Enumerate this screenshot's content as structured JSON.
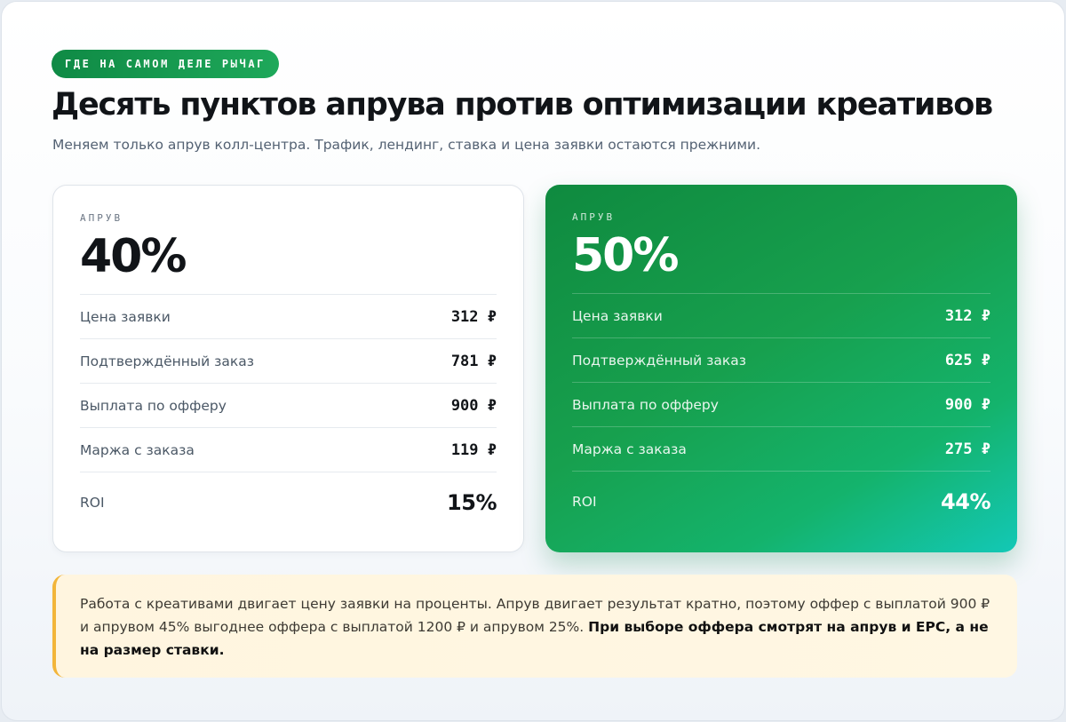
{
  "badge": "ГДЕ НА САМОМ ДЕЛЕ РЫЧАГ",
  "title": "Десять пунктов апрува против оптимизации креативов",
  "subtitle": "Меняем только апрув колл-центра. Трафик, лендинг, ставка и цена заявки остаются прежними.",
  "colors": {
    "accent_green": "#129447",
    "card_gradient_end": "#13c8b6",
    "note_background": "#fff6e0",
    "note_border": "#f2b53a"
  },
  "cards": [
    {
      "label": "АПРУВ",
      "value": "40%",
      "rows": [
        {
          "label": "Цена заявки",
          "value": "312 ₽"
        },
        {
          "label": "Подтверждённый заказ",
          "value": "781 ₽"
        },
        {
          "label": "Выплата по офферу",
          "value": "900 ₽"
        },
        {
          "label": "Маржа с заказа",
          "value": "119 ₽"
        }
      ],
      "roi": {
        "label": "ROI",
        "value": "15%"
      }
    },
    {
      "label": "АПРУВ",
      "value": "50%",
      "rows": [
        {
          "label": "Цена заявки",
          "value": "312 ₽"
        },
        {
          "label": "Подтверждённый заказ",
          "value": "625 ₽"
        },
        {
          "label": "Выплата по офферу",
          "value": "900 ₽"
        },
        {
          "label": "Маржа с заказа",
          "value": "275 ₽"
        }
      ],
      "roi": {
        "label": "ROI",
        "value": "44%"
      }
    }
  ],
  "note": {
    "text": "Работа с креативами двигает цену заявки на проценты. Апрув двигает результат кратно, поэтому оффер с выплатой 900 ₽ и апрувом 45% выгоднее оффера с выплатой 1200 ₽ и апрувом 25%. ",
    "emphasis": "При выборе оффера смотрят на апрув и EPC, а не на размер ставки."
  }
}
